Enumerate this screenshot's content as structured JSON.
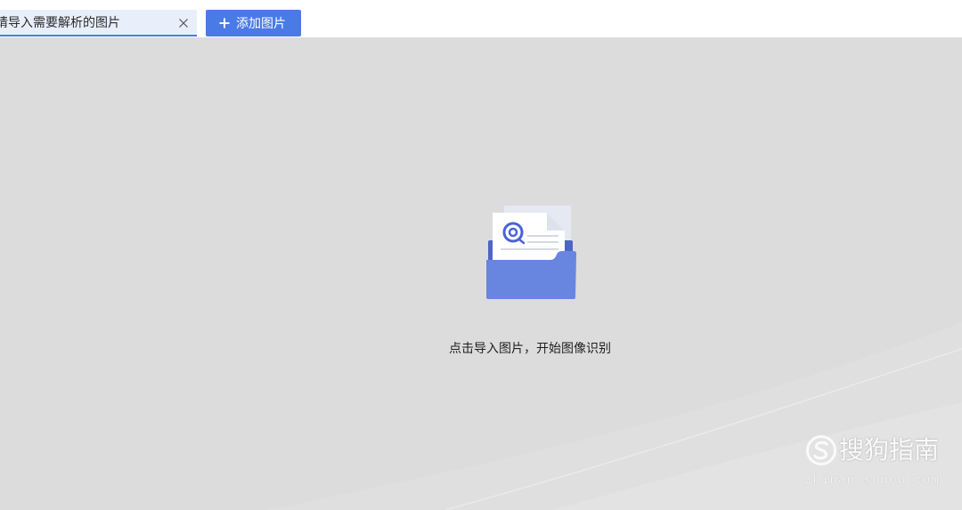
{
  "window": {
    "tabs": [
      {
        "label": "请导入需要解析的图片",
        "close_icon": "close-icon",
        "active": true
      }
    ],
    "add_button": {
      "label": "添加图片",
      "icon": "plus-icon"
    }
  },
  "main": {
    "illustration_icon": "folder-document-icon",
    "hint": "点击导入图片，开始图像识别"
  },
  "watermark": {
    "logo_icon": "sogou-s-logo-icon",
    "brand": "搜狗指南",
    "url": "zhinan.sogou.com"
  },
  "colors": {
    "accent": "#4a7ae6",
    "tab_background": "#e9eefb",
    "canvas_background": "#dcdcdc",
    "folder": "#6886e0"
  }
}
